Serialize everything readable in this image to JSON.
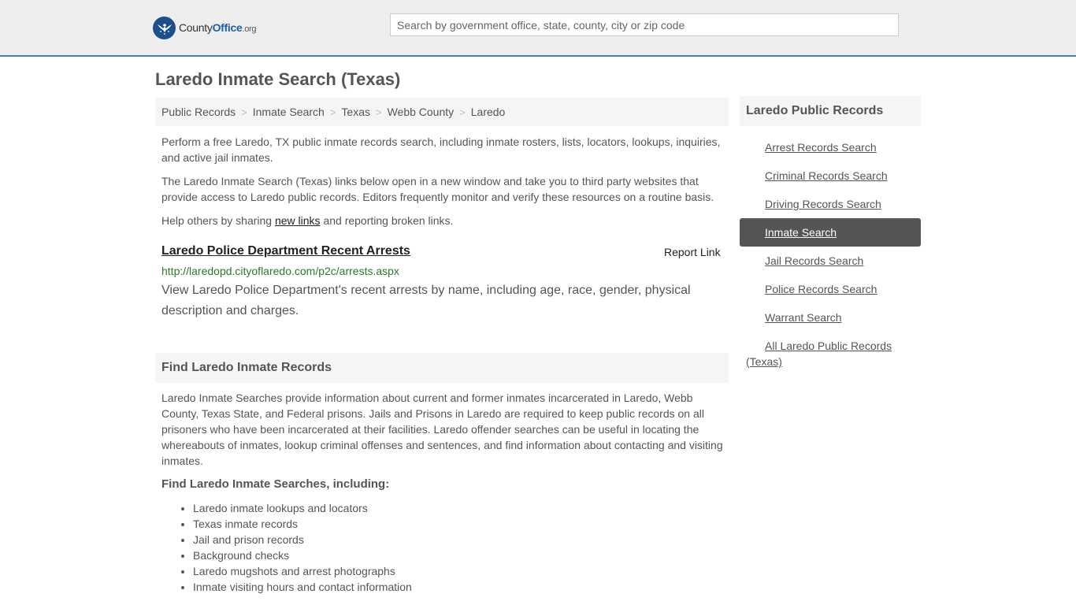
{
  "header": {
    "logo": {
      "part1": "County",
      "part2": "Office",
      "part3": ".org"
    },
    "search_placeholder": "Search by government office, state, county, city or zip code"
  },
  "page_title": "Laredo Inmate Search (Texas)",
  "breadcrumb": [
    "Public Records",
    "Inmate Search",
    "Texas",
    "Webb County",
    "Laredo"
  ],
  "intro": {
    "p1": "Perform a free Laredo, TX public inmate records search, including inmate rosters, lists, locators, lookups, inquiries, and active jail inmates.",
    "p2": "The Laredo Inmate Search (Texas) links below open in a new window and take you to third party websites that provide access to Laredo public records. Editors frequently monitor and verify these resources on a routine basis.",
    "p3_before": "Help others by sharing ",
    "p3_link": "new links",
    "p3_after": " and reporting broken links."
  },
  "listing": {
    "title": "Laredo Police Department Recent Arrests",
    "report": "Report Link",
    "url": "http://laredopd.cityoflaredo.com/p2c/arrests.aspx",
    "description": "View Laredo Police Department's recent arrests by name, including age, race, gender, physical description and charges."
  },
  "find_section": {
    "heading": "Find Laredo Inmate Records",
    "body": "Laredo Inmate Searches provide information about current and former inmates incarcerated in Laredo, Webb County, Texas State, and Federal prisons. Jails and Prisons in Laredo are required to keep public records on all prisoners who have been incarcerated at their facilities. Laredo offender searches can be useful in locating the whereabouts of inmates, lookup criminal offenses and sentences, and find information about contacting and visiting inmates.",
    "sub_heading": "Find Laredo Inmate Searches, including:",
    "items": [
      "Laredo inmate lookups and locators",
      "Texas inmate records",
      "Jail and prison records",
      "Background checks",
      "Laredo mugshots and arrest photographs",
      "Inmate visiting hours and contact information"
    ]
  },
  "sidebar": {
    "heading": "Laredo Public Records",
    "items": [
      {
        "label": "Arrest Records Search"
      },
      {
        "label": "Criminal Records Search"
      },
      {
        "label": "Driving Records Search"
      },
      {
        "label": "Inmate Search",
        "active": true
      },
      {
        "label": "Jail Records Search"
      },
      {
        "label": "Police Records Search"
      },
      {
        "label": "Warrant Search"
      }
    ],
    "all_link": "All Laredo Public Records (Texas)"
  },
  "colors": {
    "accent": "#4a7fb5",
    "url_green": "#2a7a2a",
    "active_bg": "#555555"
  }
}
